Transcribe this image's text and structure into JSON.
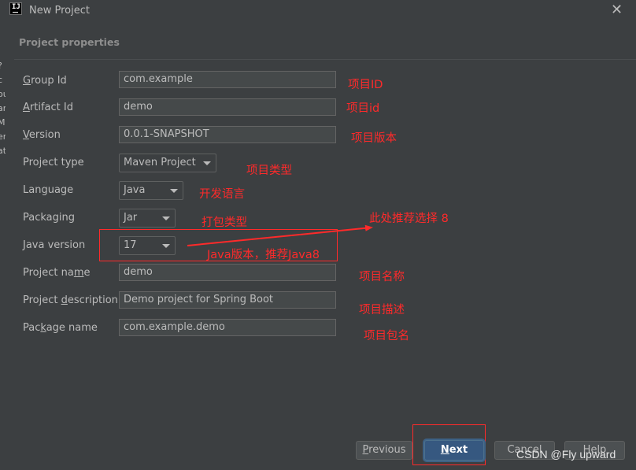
{
  "window": {
    "icon_text": "IJ",
    "title": "New Project",
    "close_glyph": "✕",
    "left_edge_chars": [
      "?",
      "c",
      "ou",
      "ar",
      "M",
      "er",
      "at"
    ]
  },
  "section_title": "Project properties",
  "fields": {
    "group_id": {
      "label_u": "G",
      "label_rest": "roup Id",
      "value": "com.example"
    },
    "artifact_id": {
      "label_u": "A",
      "label_rest": "rtifact Id",
      "value": "demo"
    },
    "version": {
      "label_u": "V",
      "label_rest": "ersion",
      "value": "0.0.1-SNAPSHOT"
    },
    "project_type": {
      "label": "Project type",
      "value": "Maven Project"
    },
    "language": {
      "label": "Language",
      "value": "Java"
    },
    "packaging": {
      "label": "Packaging",
      "value": "Jar"
    },
    "java_version": {
      "label": "Java version",
      "value": "17"
    },
    "project_name": {
      "label_pre": "Project na",
      "label_u": "m",
      "label_post": "e",
      "value": "demo"
    },
    "project_description": {
      "label_pre": "Project ",
      "label_u": "d",
      "label_post": "escription",
      "value": "Demo project for Spring Boot"
    },
    "package_name": {
      "label_pre": "Pac",
      "label_u": "k",
      "label_post": "age name",
      "value": "com.example.demo"
    }
  },
  "annotations": {
    "group_id": "项目ID",
    "artifact_id": "项目id",
    "version": "项目版本",
    "project_type": "项目类型",
    "language": "开发语言",
    "packaging": "打包类型",
    "recommend": "此处推荐选择 8",
    "java_version": "Java版本，推荐Java8",
    "project_name": "项目名称",
    "project_description": "项目描述",
    "package_name": "项目包名",
    "color": "#ff2a2a"
  },
  "buttons": {
    "previous_u": "P",
    "previous_rest": "revious",
    "next_u": "N",
    "next_rest": "ext",
    "cancel": "Cancel",
    "help": "Help"
  },
  "watermark": "CSDN @Fly upward",
  "colors": {
    "background": "#3c3f41",
    "field_bg": "#45494a",
    "primary_button": "#365880"
  }
}
